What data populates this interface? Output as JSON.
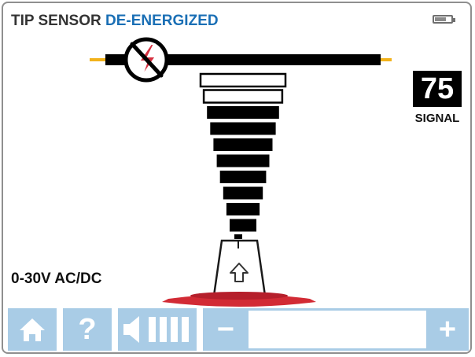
{
  "header": {
    "title_prefix": "TIP SENSOR",
    "title_status": "DE-ENERGIZED",
    "battery_level": 0.8
  },
  "signal": {
    "value": "75",
    "label": "SIGNAL"
  },
  "range": {
    "label": "0-30V AC/DC"
  },
  "meter": {
    "bars_total": 10,
    "bars_filled": 8
  },
  "toolbar": {
    "help_label": "?",
    "minus_label": "−",
    "plus_label": "+",
    "volume_bars": 4,
    "sensitivity_level": 0
  },
  "icons": {
    "home": "home-icon",
    "help": "help-icon",
    "volume": "speaker-icon",
    "voltage": "no-voltage-icon",
    "tip_arrow": "up-arrow-icon"
  },
  "colors": {
    "status_blue": "#1a6fb5",
    "button_bg": "#a9cce6",
    "voltage_red": "#d63040",
    "probe_tips": "#f2b21b",
    "base_red": "#d22b35"
  }
}
